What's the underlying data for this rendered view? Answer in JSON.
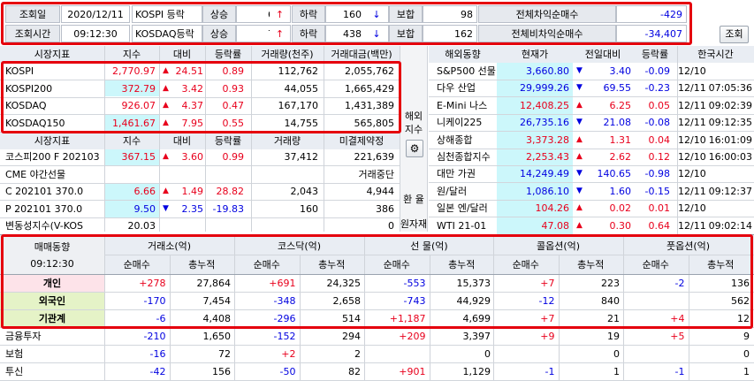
{
  "top": {
    "row1": {
      "label": "조회일",
      "value": "2020/12/11",
      "mkt": "KOSPI 등락",
      "up_lbl": "상승",
      "up": "631",
      "up_arrow": "↑",
      "dn_lbl": "하락",
      "dn": "160",
      "dn_arrow": "↓",
      "flat_lbl": "보합",
      "flat": "98",
      "net_lbl": "전체차익순매수",
      "net": "-429"
    },
    "row2": {
      "label": "조회시간",
      "value": "09:12:30",
      "mkt": "KOSDAQ등락",
      "up_lbl": "상승",
      "up": "758",
      "up_arrow": "↑",
      "dn_lbl": "하락",
      "dn": "438",
      "dn_arrow": "↓",
      "flat_lbl": "보합",
      "flat": "162",
      "net_lbl": "전체비차익순매수",
      "net": "-34,407"
    },
    "query_button": "조회"
  },
  "idx": {
    "headers": [
      "시장지표",
      "지수",
      "대비",
      "등락률",
      "거래량(천주)",
      "거래대금(백만)"
    ],
    "rows": [
      {
        "name": "KOSPI",
        "v": "2,770.97",
        "arrow": "▲",
        "chg": "24.51",
        "rate": "0.89",
        "vol": "112,762",
        "amt": "2,055,762"
      },
      {
        "name": "KOSPI200",
        "v": "372.79",
        "arrow": "▲",
        "chg": "3.42",
        "rate": "0.93",
        "vol": "44,055",
        "amt": "1,665,429"
      },
      {
        "name": "KOSDAQ",
        "v": "926.07",
        "arrow": "▲",
        "chg": "4.37",
        "rate": "0.47",
        "vol": "167,170",
        "amt": "1,431,389"
      },
      {
        "name": "KOSDAQ150",
        "v": "1,461.67",
        "arrow": "▲",
        "chg": "7.95",
        "rate": "0.55",
        "vol": "14,755",
        "amt": "565,805"
      }
    ]
  },
  "deriv": {
    "headers": [
      "시장지표",
      "지수",
      "대비",
      "등락률",
      "거래량",
      "미결제약정"
    ],
    "rows": [
      {
        "name": "코스피200 F 202103",
        "v": "367.15",
        "arrow": "▲",
        "chg": "3.60",
        "rate": "0.99",
        "vol": "37,412",
        "oi": "221,639"
      },
      {
        "name": "CME 야간선물",
        "v": "",
        "arrow": "",
        "chg": "",
        "rate": "",
        "vol": "",
        "oi": "거래중단"
      },
      {
        "name": "C 202101 370.0",
        "v": "6.66",
        "arrow": "▲",
        "chg": "1.49",
        "rate": "28.82",
        "vol": "2,043",
        "oi": "4,944"
      },
      {
        "name": "P 202101 370.0",
        "v": "9.50",
        "arrow": "▼",
        "chg": "2.35",
        "rate": "-19.83",
        "vol": "160",
        "oi": "386"
      },
      {
        "name": "변동성지수(V-KOS",
        "v": "20.03",
        "arrow": "",
        "chg": "",
        "rate": "",
        "vol": "",
        "oi": "0"
      }
    ]
  },
  "side": {
    "overseas": "해외\n지수",
    "gear": "⚙",
    "fx": "환 율",
    "raw": "원자재"
  },
  "world": {
    "headers": [
      "해외동향",
      "현재가",
      "전일대비",
      "등락률",
      "한국시간"
    ],
    "rows": [
      {
        "name": "S&P500 선물",
        "v": "3,660.80",
        "arrow": "▼",
        "chg": "3.40",
        "rate": "-0.09",
        "date": "12/10",
        "time": ""
      },
      {
        "name": "다우 산업",
        "v": "29,999.26",
        "arrow": "▼",
        "chg": "69.55",
        "rate": "-0.23",
        "date": "12/11",
        "time": "07:05:36"
      },
      {
        "name": "E-Mini 나스",
        "v": "12,408.25",
        "arrow": "▲",
        "chg": "6.25",
        "rate": "0.05",
        "date": "12/11",
        "time": "09:02:39"
      },
      {
        "name": "니케이225",
        "v": "26,735.16",
        "arrow": "▼",
        "chg": "21.08",
        "rate": "-0.08",
        "date": "12/11",
        "time": "09:12:35"
      },
      {
        "name": "상해종합",
        "v": "3,373.28",
        "arrow": "▲",
        "chg": "1.31",
        "rate": "0.04",
        "date": "12/10",
        "time": "16:01:09"
      },
      {
        "name": "심천종합지수",
        "v": "2,253.43",
        "arrow": "▲",
        "chg": "2.62",
        "rate": "0.12",
        "date": "12/10",
        "time": "16:00:03"
      },
      {
        "name": "대만 가권",
        "v": "14,249.49",
        "arrow": "▼",
        "chg": "140.65",
        "rate": "-0.98",
        "date": "12/10",
        "time": ""
      },
      {
        "name": "원/달러",
        "v": "1,086.10",
        "arrow": "▼",
        "chg": "1.60",
        "rate": "-0.15",
        "date": "12/11",
        "time": "09:12:37"
      },
      {
        "name": "일본 엔/달러",
        "v": "104.26",
        "arrow": "▲",
        "chg": "0.02",
        "rate": "0.01",
        "date": "12/10",
        "time": ""
      },
      {
        "name": "WTI 21-01",
        "v": "47.08",
        "arrow": "▲",
        "chg": "0.30",
        "rate": "0.64",
        "date": "12/11",
        "time": "09:02:14"
      }
    ]
  },
  "trade": {
    "title": "매매동향",
    "time": "09:12:30",
    "groups": [
      "거래소(억)",
      "코스닥(억)",
      "선 물(억)",
      "콜옵션(억)",
      "풋옵션(억)"
    ],
    "sub": [
      "순매수",
      "총누적"
    ],
    "rows": [
      {
        "name": "개인",
        "vals": [
          "+278",
          "27,864",
          "+691",
          "24,325",
          "-553",
          "15,373",
          "+7",
          "223",
          "-2",
          "136"
        ]
      },
      {
        "name": "외국인",
        "vals": [
          "-170",
          "7,454",
          "-348",
          "2,658",
          "-743",
          "44,929",
          "-12",
          "840",
          "",
          "562"
        ]
      },
      {
        "name": "기관계",
        "vals": [
          "-6",
          "4,408",
          "-296",
          "514",
          "+1,187",
          "4,699",
          "+7",
          "21",
          "+4",
          "12"
        ]
      },
      {
        "name": "금융투자",
        "vals": [
          "-210",
          "1,650",
          "-152",
          "294",
          "+209",
          "3,397",
          "+9",
          "19",
          "+5",
          "9"
        ]
      },
      {
        "name": "보험",
        "vals": [
          "-16",
          "72",
          "+2",
          "2",
          "",
          "0",
          "",
          "0",
          "",
          "0"
        ]
      },
      {
        "name": "투신",
        "vals": [
          "-42",
          "156",
          "-50",
          "82",
          "+901",
          "1,129",
          "-1",
          "1",
          "-1",
          "1"
        ]
      }
    ]
  }
}
